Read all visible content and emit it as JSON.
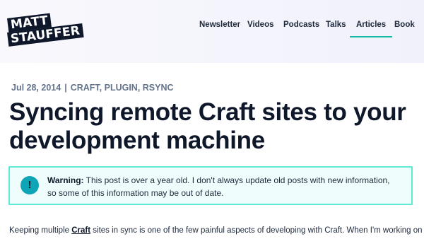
{
  "logo": {
    "line1": "MATT",
    "line2": "STAUFFER"
  },
  "nav": [
    {
      "label": "Newsletter"
    },
    {
      "label": "Videos"
    },
    {
      "label": "Podcasts"
    },
    {
      "label": "Talks"
    },
    {
      "label": "Articles",
      "active": true
    },
    {
      "label": "Book"
    }
  ],
  "post": {
    "date": "Jul 28, 2014",
    "separator": "|",
    "tags": "CRAFT, PLUGIN, RSYNC",
    "title": "Syncing remote Craft sites to your development machine",
    "warning": {
      "icon": "!",
      "label": "Warning:",
      "text": " This post is over a year old. I don't always update old posts with new information, so some of this information may be out of date."
    },
    "intro_before": "Keeping multiple ",
    "intro_link": "Craft",
    "intro_after": " sites in sync is one of the few painful aspects of developing with Craft. When I'm working on my"
  },
  "colors": {
    "accent": "#14b8a6",
    "warning_bg": "#effdfc",
    "warning_border": "#5eead4",
    "icon_bg": "#0ea5b7"
  }
}
